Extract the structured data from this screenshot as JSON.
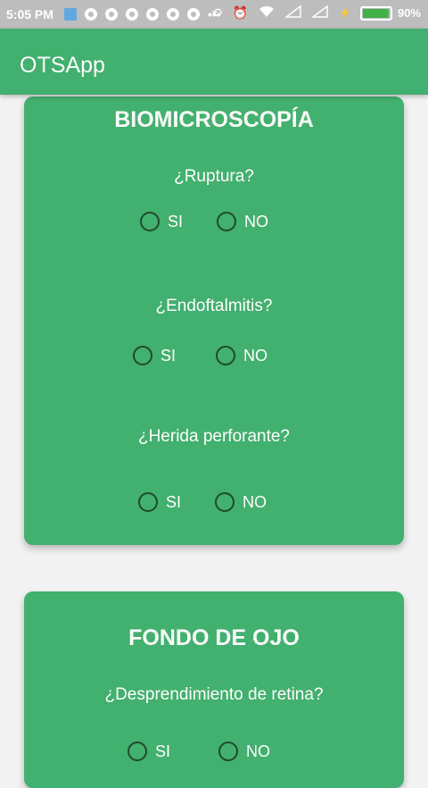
{
  "status_bar": {
    "time": "5:05 PM",
    "battery_percent": "90%",
    "battery_level": 0.9,
    "left_icons": [
      "notification-icon",
      "whatsapp-icon",
      "whatsapp-icon",
      "whatsapp-icon",
      "whatsapp-icon",
      "whatsapp-icon",
      "whatsapp-icon",
      "more-dots-icon"
    ],
    "right_icons": [
      "rotate-icon",
      "alarm-icon",
      "wifi-icon",
      "signal-icon",
      "signal-icon",
      "charging-icon"
    ]
  },
  "app_bar": {
    "title": "OTSApp"
  },
  "cards": [
    {
      "title": "BIOMICROSCOPÍA",
      "questions": [
        {
          "label": "¿Ruptura?",
          "options": [
            "SI",
            "NO"
          ]
        },
        {
          "label": "¿Endoftalmitis?",
          "options": [
            "SI",
            "NO"
          ]
        },
        {
          "label": "¿Herida perforante?",
          "options": [
            "SI",
            "NO"
          ]
        }
      ]
    },
    {
      "title": "FONDO DE OJO",
      "questions": [
        {
          "label": "¿Desprendimiento de retina?",
          "options": [
            "SI",
            "NO"
          ]
        }
      ]
    }
  ],
  "colors": {
    "primary": "#42b06e",
    "status_bar": "#bdbdbd",
    "background": "#f2f2f2",
    "radio_border": "#1f4a2e",
    "text": "#ffffff"
  }
}
